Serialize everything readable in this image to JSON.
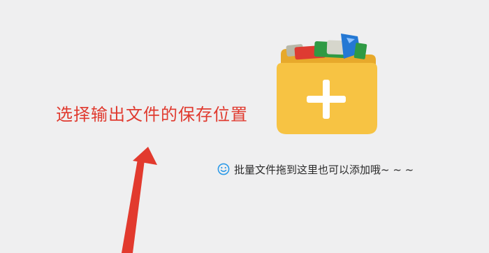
{
  "annotation": {
    "text": "选择输出文件的保存位置"
  },
  "drop_area": {
    "hint_text": "批量文件拖到这里也可以添加哦~ ~ ~",
    "hint_icon": "smile-icon",
    "add_icon": "folder-add-icon"
  },
  "colors": {
    "background": "#efeff0",
    "annotation": "#e03a2f",
    "arrow": "#e23a2e",
    "folder_body": "#f7c343",
    "folder_back": "#e7a92b",
    "hint_icon": "#2e9be8",
    "hint_text": "#2a2a2a",
    "plus": "#ffffff"
  }
}
